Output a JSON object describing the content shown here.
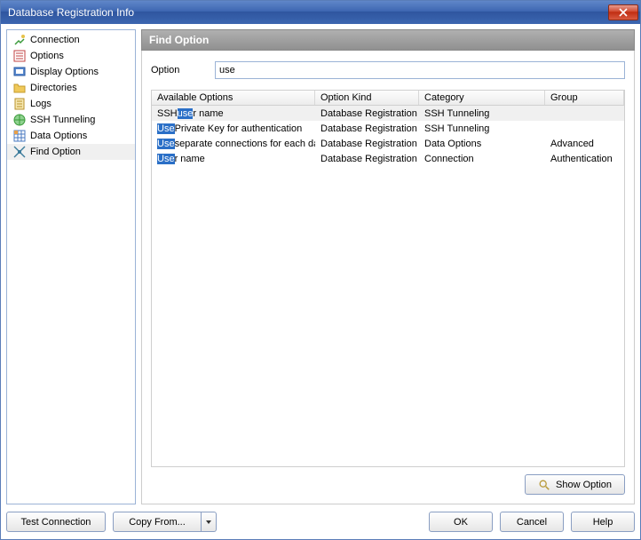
{
  "window": {
    "title": "Database Registration Info"
  },
  "sidebar": {
    "items": [
      {
        "label": "Connection"
      },
      {
        "label": "Options"
      },
      {
        "label": "Display Options"
      },
      {
        "label": "Directories"
      },
      {
        "label": "Logs"
      },
      {
        "label": "SSH Tunneling"
      },
      {
        "label": "Data Options"
      },
      {
        "label": "Find Option"
      }
    ],
    "selected_index": 7
  },
  "panel": {
    "title": "Find Option",
    "option_label": "Option",
    "option_value": "use"
  },
  "table": {
    "headers": {
      "available": "Available Options",
      "kind": "Option Kind",
      "category": "Category",
      "group": "Group"
    },
    "highlight": "use",
    "rows": [
      {
        "pre": "SSH ",
        "hl": "use",
        "post": "r name",
        "kind": "Database Registration Info",
        "category": "SSH Tunneling",
        "group": "",
        "selected": true
      },
      {
        "pre": "",
        "hl": "Use",
        "post": " Private Key for authentication",
        "kind": "Database Registration Info",
        "category": "SSH Tunneling",
        "group": "",
        "selected": false
      },
      {
        "pre": "",
        "hl": "Use",
        "post": " separate connections for each data view within a database",
        "kind": "Database Registration Info",
        "category": "Data Options",
        "group": "Advanced",
        "selected": false
      },
      {
        "pre": "",
        "hl": "Use",
        "post": "r name",
        "kind": "Database Registration Info",
        "category": "Connection",
        "group": "Authentication",
        "selected": false
      }
    ]
  },
  "buttons": {
    "show_option": "Show Option",
    "test_connection": "Test Connection",
    "copy_from": "Copy From...",
    "ok": "OK",
    "cancel": "Cancel",
    "help": "Help"
  },
  "icons": {
    "close": "✕"
  }
}
